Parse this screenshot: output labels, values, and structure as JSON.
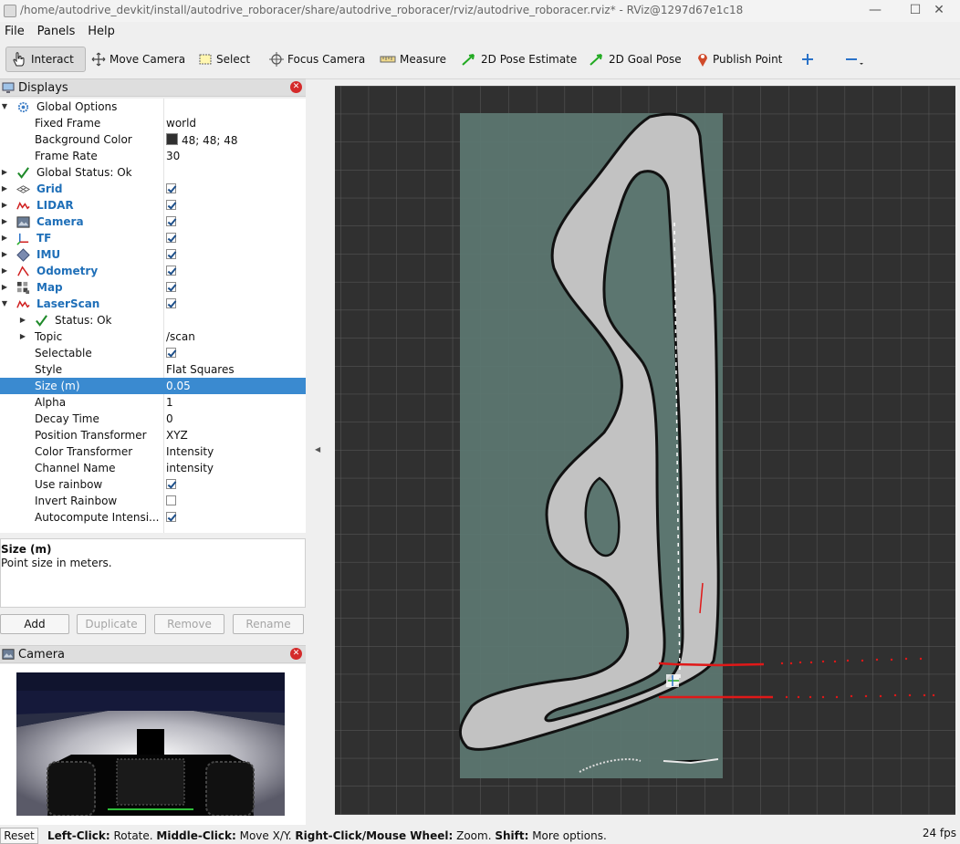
{
  "window": {
    "title": "/home/autodrive_devkit/install/autodrive_roboracer/share/autodrive_roboracer/rviz/autodrive_roboracer.rviz* - RViz@1297d67e1c18",
    "minimize": "—",
    "maximize": "☐",
    "close": "✕"
  },
  "menu": [
    "File",
    "Panels",
    "Help"
  ],
  "toolbar": {
    "interact": "Interact",
    "move_camera": "Move Camera",
    "select": "Select",
    "focus_camera": "Focus Camera",
    "measure": "Measure",
    "pose_estimate": "2D Pose Estimate",
    "goal_pose": "2D Goal Pose",
    "publish_point": "Publish Point",
    "colors": {
      "pose_arrow": "#22aa22",
      "publish_pin": "#d04a2a",
      "plus": "#2a72c8"
    }
  },
  "displays_panel": {
    "title": "Displays",
    "rows": [
      {
        "name": "Global Options"
      },
      {
        "name": "Fixed Frame",
        "value": "world"
      },
      {
        "name": "Background Color",
        "value": "48; 48; 48"
      },
      {
        "name": "Frame Rate",
        "value": "30"
      },
      {
        "name": "Global Status: Ok"
      },
      {
        "name": "Grid",
        "checked": true
      },
      {
        "name": "LIDAR",
        "checked": true
      },
      {
        "name": "Camera",
        "checked": true
      },
      {
        "name": "TF",
        "checked": true
      },
      {
        "name": "IMU",
        "checked": true
      },
      {
        "name": "Odometry",
        "checked": true
      },
      {
        "name": "Map",
        "checked": true
      },
      {
        "name": "LaserScan",
        "checked": true
      },
      {
        "name": "Status: Ok"
      },
      {
        "name": "Topic",
        "value": "/scan"
      },
      {
        "name": "Selectable",
        "checked": true
      },
      {
        "name": "Style",
        "value": "Flat Squares"
      },
      {
        "name": "Size (m)",
        "value": "0.05"
      },
      {
        "name": "Alpha",
        "value": "1"
      },
      {
        "name": "Decay Time",
        "value": "0"
      },
      {
        "name": "Position Transformer",
        "value": "XYZ"
      },
      {
        "name": "Color Transformer",
        "value": "Intensity"
      },
      {
        "name": "Channel Name",
        "value": "intensity"
      },
      {
        "name": "Use rainbow",
        "checked": true
      },
      {
        "name": "Invert Rainbow",
        "checked": false
      },
      {
        "name": "Autocompute Intensi...",
        "checked": true
      }
    ],
    "description": {
      "title": "Size (m)",
      "text": "Point size in meters."
    },
    "buttons": {
      "add": "Add",
      "duplicate": "Duplicate",
      "remove": "Remove",
      "rename": "Rename"
    }
  },
  "camera_panel": {
    "title": "Camera"
  },
  "viewport": {
    "background_color": "#303030",
    "map_area_color": "#5c7670",
    "track_color": "#c2c2c2",
    "scan_color": "#e01818"
  },
  "status_bar": {
    "reset": "Reset",
    "hint_segments": [
      {
        "text": "Left-Click:",
        "bold": true
      },
      {
        "text": " Rotate. ",
        "bold": false
      },
      {
        "text": "Middle-Click:",
        "bold": true
      },
      {
        "text": " Move X/Y. ",
        "bold": false
      },
      {
        "text": "Right-Click/Mouse Wheel:",
        "bold": true
      },
      {
        "text": " Zoom. ",
        "bold": false
      },
      {
        "text": "Shift:",
        "bold": true
      },
      {
        "text": " More options.",
        "bold": false
      }
    ],
    "fps": "24 fps"
  }
}
